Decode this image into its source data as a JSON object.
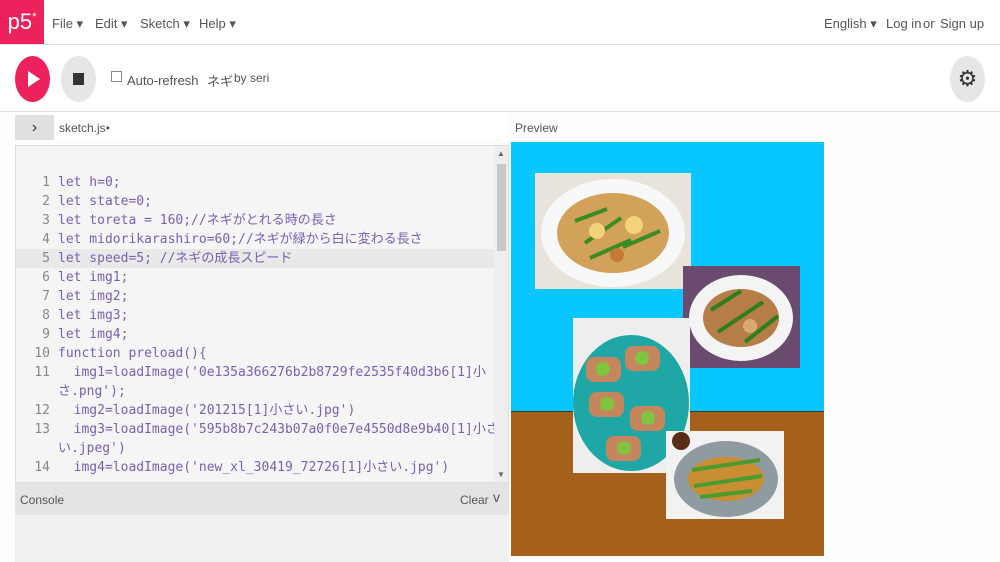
{
  "nav": {
    "logo": "p5",
    "logo_mark": "*",
    "file": "File ▾",
    "edit": "Edit ▾",
    "sketch": "Sketch ▾",
    "help": "Help ▾",
    "language": "English ▾",
    "login": "Log in",
    "or": "or",
    "signup": "Sign up"
  },
  "toolbar": {
    "auto_refresh": "Auto-refresh",
    "sketch_name": "ネギ",
    "author": "by seri"
  },
  "editor": {
    "collapse_icon": "›",
    "file_name": "sketch.js",
    "unsaved_marker": "•",
    "lines": [
      {
        "num": "1",
        "code": "let h=0;"
      },
      {
        "num": "2",
        "code": "let state=0;"
      },
      {
        "num": "3",
        "code": "let toreta = 160;//ネギがとれる時の長さ"
      },
      {
        "num": "4",
        "code": "let midorikarashiro=60;//ネギが緑から白に変わる長さ"
      },
      {
        "num": "5",
        "code": "let speed=5; //ネギの成長スピード"
      },
      {
        "num": "6",
        "code": "let img1;"
      },
      {
        "num": "7",
        "code": "let img2;"
      },
      {
        "num": "8",
        "code": "let img3;"
      },
      {
        "num": "9",
        "code": "let img4;"
      },
      {
        "num": "10",
        "code": "function preload(){"
      },
      {
        "num": "11",
        "code": "  img1=loadImage('0e135a366276b2b8729fe2535f40d3b6[1]小"
      },
      {
        "num": "",
        "code": "さ.png');"
      },
      {
        "num": "12",
        "code": "  img2=loadImage('201215[1]小さい.jpg')"
      },
      {
        "num": "13",
        "code": "  img3=loadImage('595b8b7c243b07a0f0e7e4550d8e9b40[1]小さ"
      },
      {
        "num": "",
        "code": "い.jpeg')"
      },
      {
        "num": "14",
        "code": "  img4=loadImage('new_xl_30419_72726[1]小さい.jpg')"
      }
    ]
  },
  "console": {
    "title": "Console",
    "clear": "Clear",
    "toggle_icon": "v"
  },
  "preview": {
    "title": "Preview"
  },
  "colors": {
    "brand": "#ed225d",
    "sky": "#08c6ff",
    "ground": "#a5601a"
  },
  "icons": {
    "play": "play-icon",
    "stop": "stop-icon",
    "settings": "gear-icon"
  }
}
